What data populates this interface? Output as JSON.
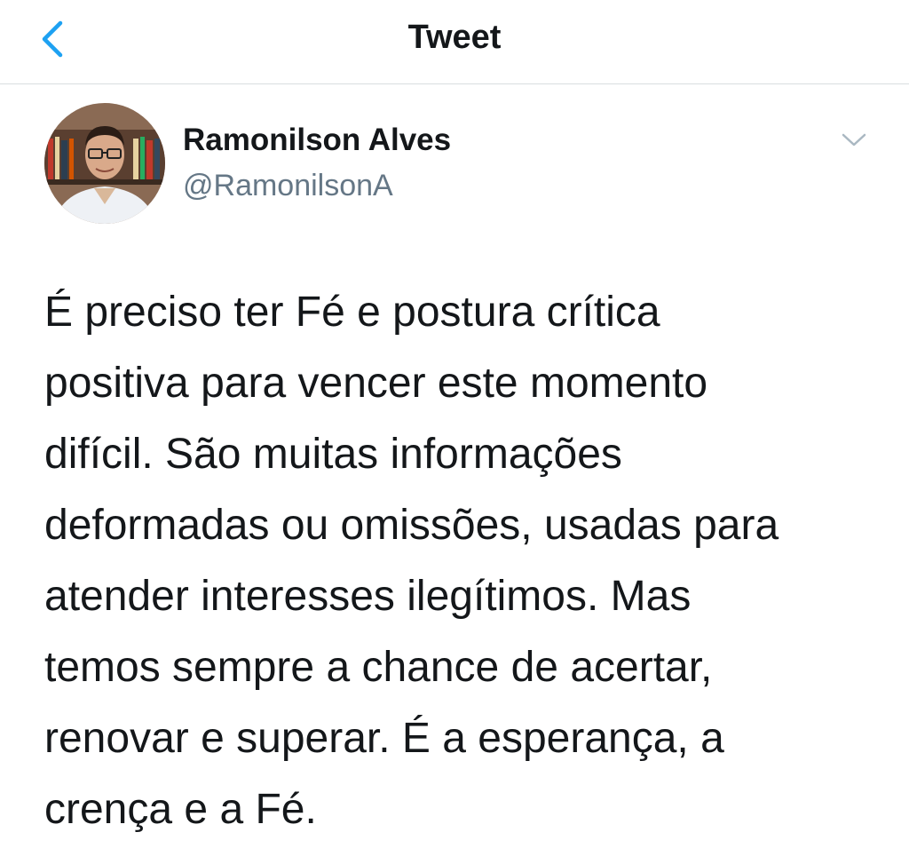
{
  "nav": {
    "title": "Tweet",
    "back_icon": "chevron-left-icon",
    "accent_color": "#1da1f2"
  },
  "tweet": {
    "author": {
      "display_name": "Ramonilson Alves",
      "handle": "@RamonilsonA",
      "avatar": "profile-photo"
    },
    "menu_icon": "chevron-down-icon",
    "text": "É preciso ter Fé e postura crítica\npositiva para vencer este momento\ndifícil. São muitas informações\ndeformadas ou omissões, usadas para\natender interesses ilegítimos. Mas\ntemos sempre a chance de acertar,\nrenovar e superar. É a esperança, a\ncrença e a Fé."
  }
}
